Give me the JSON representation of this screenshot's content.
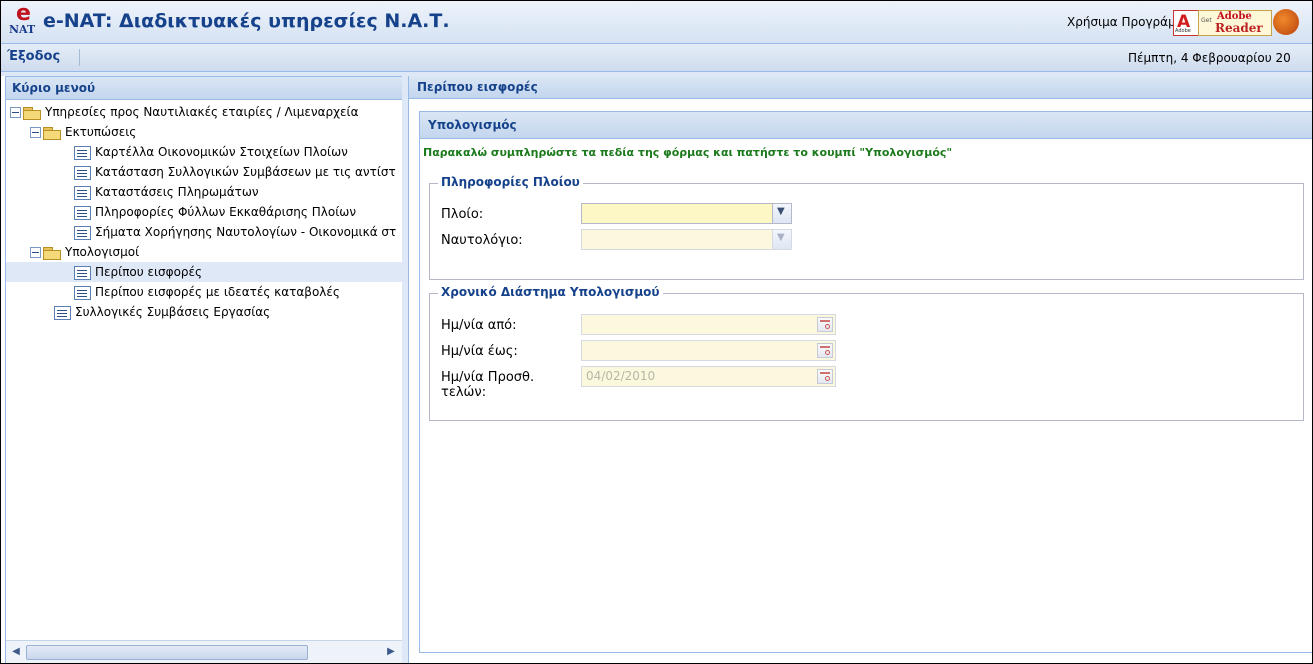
{
  "header": {
    "logo_e": "e",
    "logo_nat": "NAT",
    "title": "e-NAT: Διαδικτυακές υπηρεσίες Ν.Α.Τ.",
    "useful_programs_label": "Χρήσιμα Προγράμματα:",
    "adobe_get": "Get",
    "adobe_brand": "Adobe",
    "adobe_reader": "Reader",
    "adobe_small": "Adobe"
  },
  "toolbar": {
    "exit_label": "Έξοδος",
    "date": "Πέμπτη, 4 Φεβρουαρίου 20"
  },
  "menu": {
    "title": "Κύριο μενού",
    "items": [
      {
        "label": "Υπηρεσίες προς Ναυτιλιακές εταιρίες / Λιμεναρχεία",
        "type": "folder",
        "level": 0
      },
      {
        "label": "Εκτυπώσεις",
        "type": "folder",
        "level": 1
      },
      {
        "label": "Καρτέλλα Οικονομικών Στοιχείων Πλοίων",
        "type": "leaf",
        "level": 2
      },
      {
        "label": "Κατάσταση Συλλογικών Συμβάσεων με τις αντίστ",
        "type": "leaf",
        "level": 2
      },
      {
        "label": "Καταστάσεις Πληρωμάτων",
        "type": "leaf",
        "level": 2
      },
      {
        "label": "Πληροφορίες Φύλλων Εκκαθάρισης Πλοίων",
        "type": "leaf",
        "level": 2
      },
      {
        "label": "Σήματα Χορήγησης Ναυτολογίων - Οικονομικά στ",
        "type": "leaf",
        "level": 2
      },
      {
        "label": "Υπολογισμοί",
        "type": "folder",
        "level": 1
      },
      {
        "label": "Περίπου εισφορές",
        "type": "leaf",
        "level": 2,
        "selected": true
      },
      {
        "label": "Περίπου εισφορές με ιδεατές καταβολές",
        "type": "leaf",
        "level": 2
      },
      {
        "label": "Συλλογικές Συμβάσεις Εργασίας",
        "type": "leaf",
        "level": 1
      }
    ]
  },
  "content": {
    "panel_title": "Περίπου εισφορές",
    "form": {
      "title": "Υπολογισμός",
      "instruction": "Παρακαλώ συμπληρώστε τα πεδία της φόρμας και πατήστε το κουμπί \"Υπολογισμός\"",
      "ship_info": {
        "legend": "Πληροφορίες Πλοίου",
        "ship_label": "Πλοίο:",
        "ship_value": "",
        "crewlist_label": "Ναυτολόγιο:",
        "crewlist_value": ""
      },
      "period": {
        "legend": "Χρονικό Διάστημα Υπολογισμού",
        "from_label": "Ημ/νία από:",
        "from_value": "",
        "to_label": "Ημ/νία έως:",
        "to_value": "",
        "addfees_label_1": "Ημ/νία Προσθ.",
        "addfees_label_2": "τελών:",
        "addfees_value": "04/02/2010"
      }
    }
  }
}
